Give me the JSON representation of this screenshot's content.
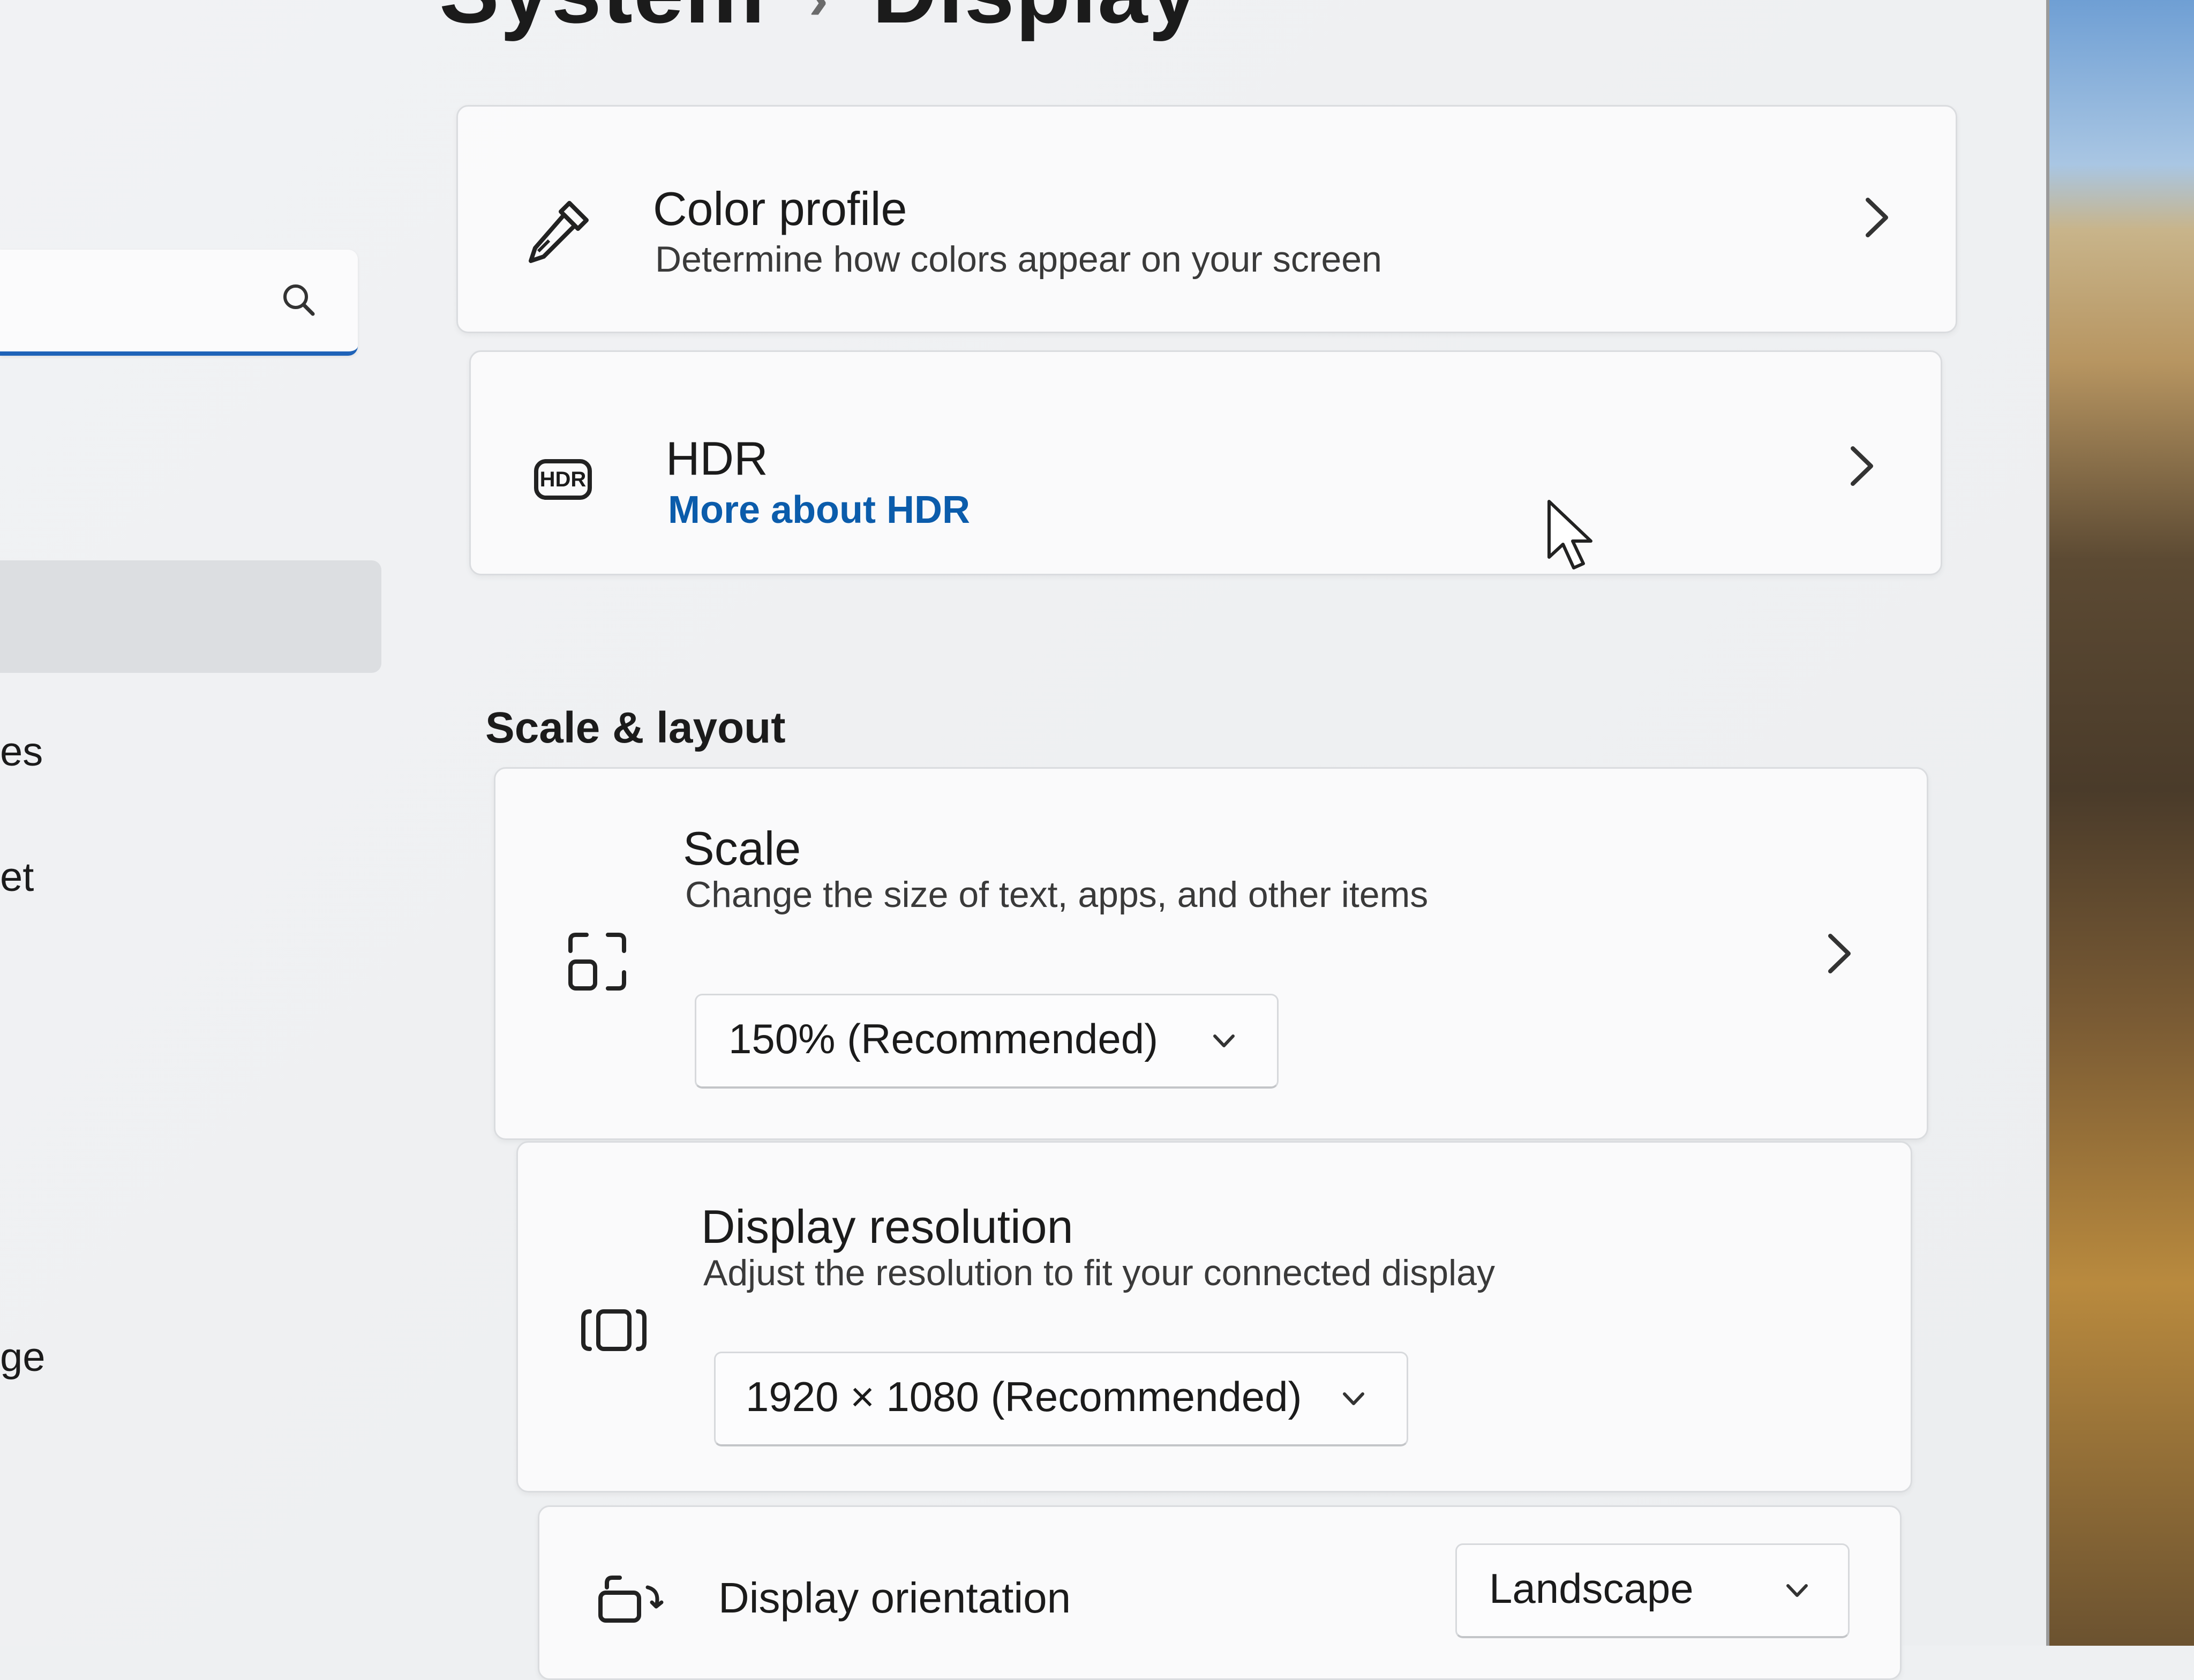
{
  "header": {
    "breadcrumb_parent": "System",
    "breadcrumb_separator": "›",
    "breadcrumb_current": "Display"
  },
  "sidebar": {
    "search_placeholder": "",
    "items": [
      {
        "label": "es"
      },
      {
        "label": "et"
      },
      {
        "label": "ge"
      }
    ]
  },
  "cards": {
    "color_profile": {
      "title": "Color profile",
      "description": "Determine how colors appear on your screen",
      "icon": "eyedropper-icon"
    },
    "hdr": {
      "title": "HDR",
      "link": "More about HDR",
      "icon_text": "HDR"
    }
  },
  "scale_layout": {
    "section_title": "Scale & layout",
    "scale": {
      "title": "Scale",
      "description": "Change the size of text, apps, and other items",
      "value": "150% (Recommended)"
    },
    "resolution": {
      "title": "Display resolution",
      "description": "Adjust the resolution to fit your connected display",
      "value": "1920 × 1080 (Recommended)"
    },
    "orientation": {
      "title": "Display orientation",
      "value": "Landscape"
    }
  },
  "colors": {
    "accent": "#1f63b8",
    "link": "#0b5cab"
  }
}
